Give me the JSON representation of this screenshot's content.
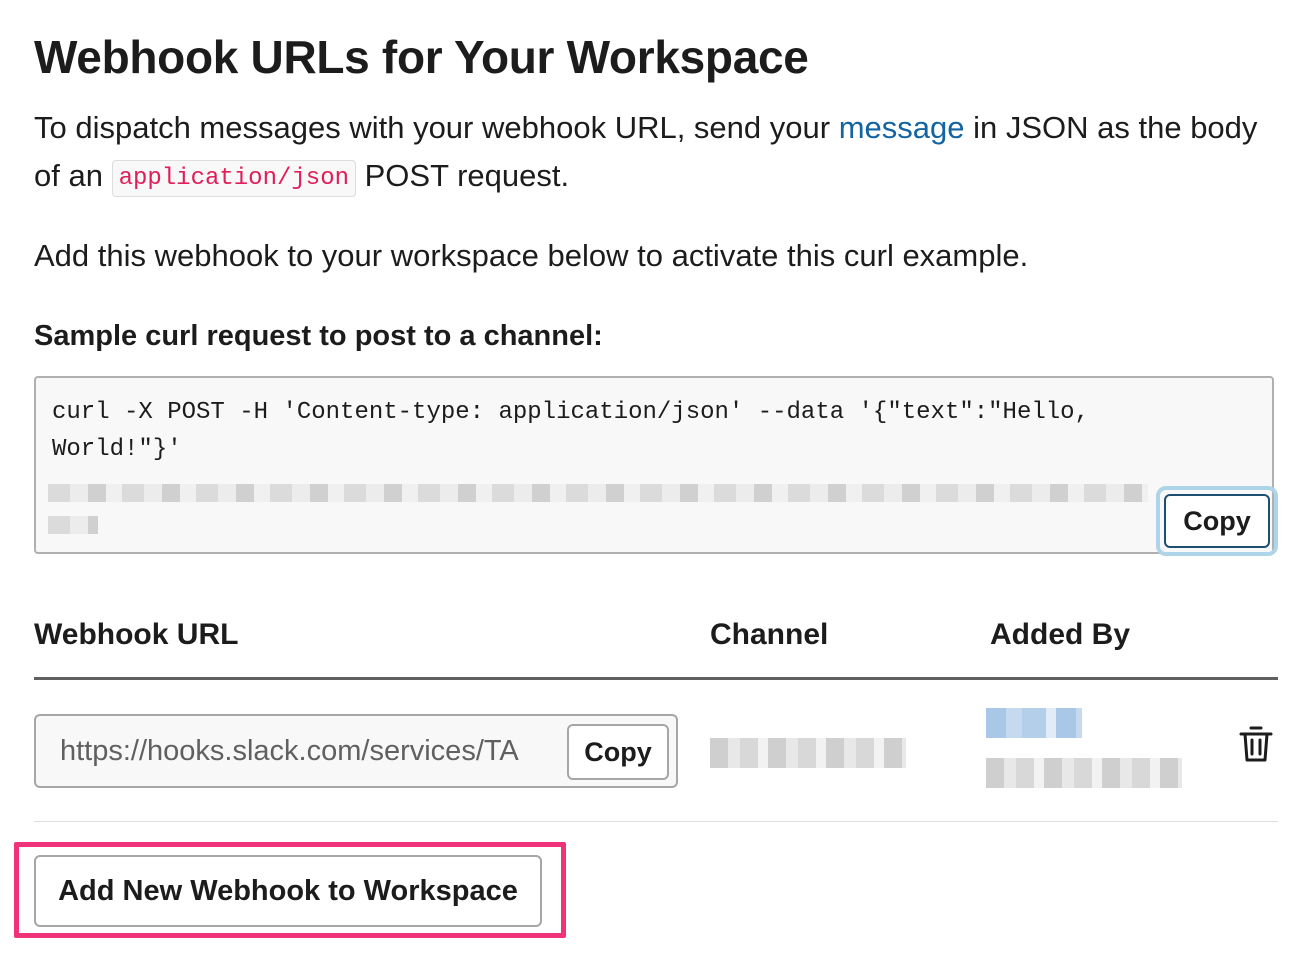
{
  "page": {
    "title": "Webhook URLs for Your Workspace",
    "intro": {
      "before_link": "To dispatch messages with your webhook URL, send your ",
      "link_text": "message",
      "after_link": " in JSON as the body of an ",
      "code": "application/json",
      "after_code": " POST request."
    },
    "activate_text": "Add this webhook to your workspace below to activate this curl example.",
    "sample_heading": "Sample curl request to post to a channel:"
  },
  "curl": {
    "code": "curl -X POST -H 'Content-type: application/json' --data '{\"text\":\"Hello, World!\"}'",
    "copy_label": "Copy"
  },
  "table": {
    "headers": {
      "url": "Webhook URL",
      "channel": "Channel",
      "added_by": "Added By"
    },
    "rows": [
      {
        "url": "https://hooks.slack.com/services/TA",
        "copy_label": "Copy"
      }
    ]
  },
  "actions": {
    "add_button_label": "Add New Webhook to Workspace"
  },
  "colors": {
    "link": "#1264a3",
    "code_text": "#e01e5a",
    "focus_ring": "#aed4ea",
    "highlight_outline": "#f0327a"
  },
  "icons": {
    "delete": "trash-icon"
  }
}
